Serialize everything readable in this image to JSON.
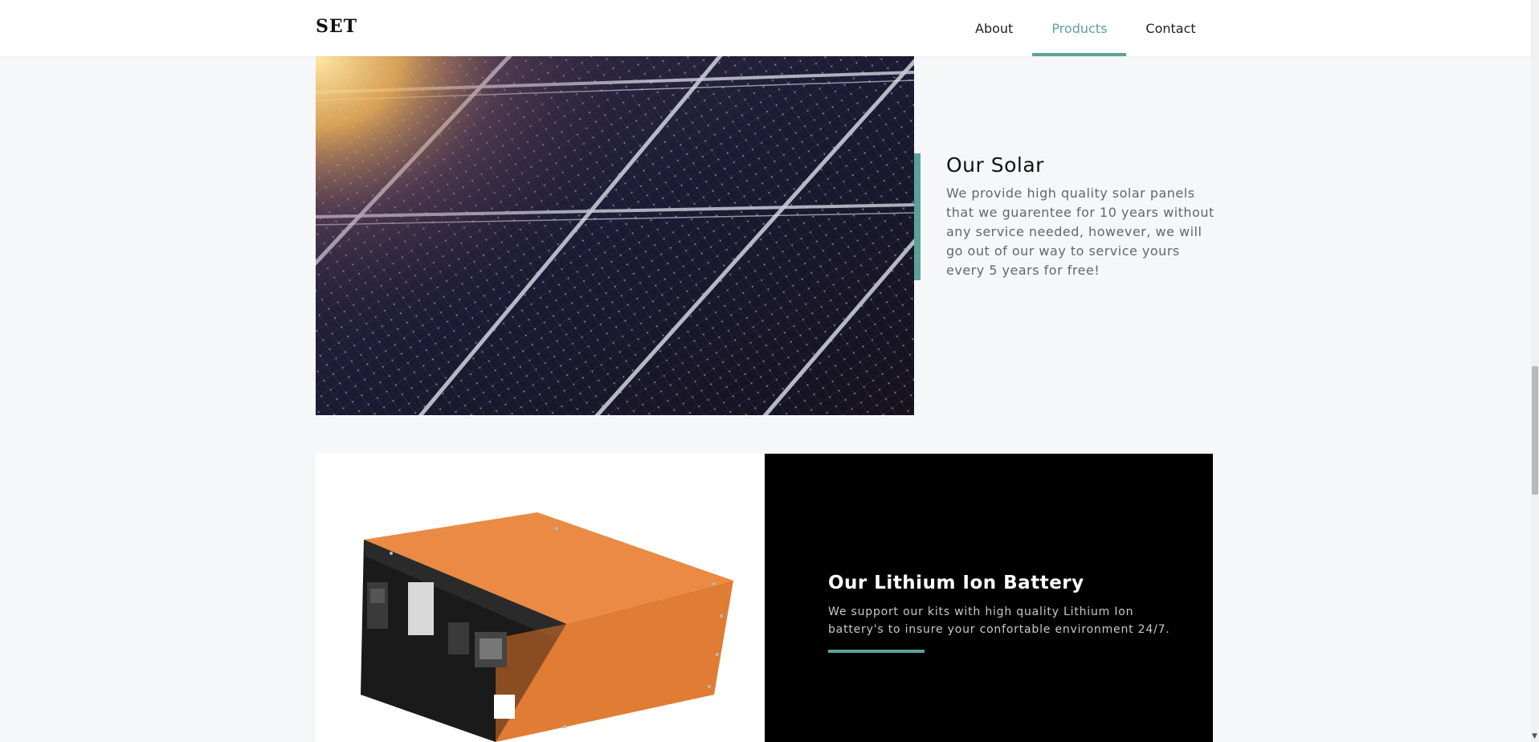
{
  "header": {
    "brand": "SET",
    "nav": [
      {
        "label": "About",
        "active": false
      },
      {
        "label": "Products",
        "active": true
      },
      {
        "label": "Contact",
        "active": false
      }
    ]
  },
  "solar": {
    "title": "Our Solar",
    "description": "We provide high quality solar panels that we guarentee for 10 years without any service needed, however, we will go out of our way to service yours every 5 years for free!"
  },
  "battery": {
    "title": "Our Lithium Ion Battery",
    "description": "We support our kits with high quality Lithium Ion battery's to insure your confortable environment 24/7."
  },
  "colors": {
    "accent": "#5ba29a",
    "background": "#f6f7f8",
    "battery_panel": "#000000",
    "battery_orange": "#e07c33"
  }
}
